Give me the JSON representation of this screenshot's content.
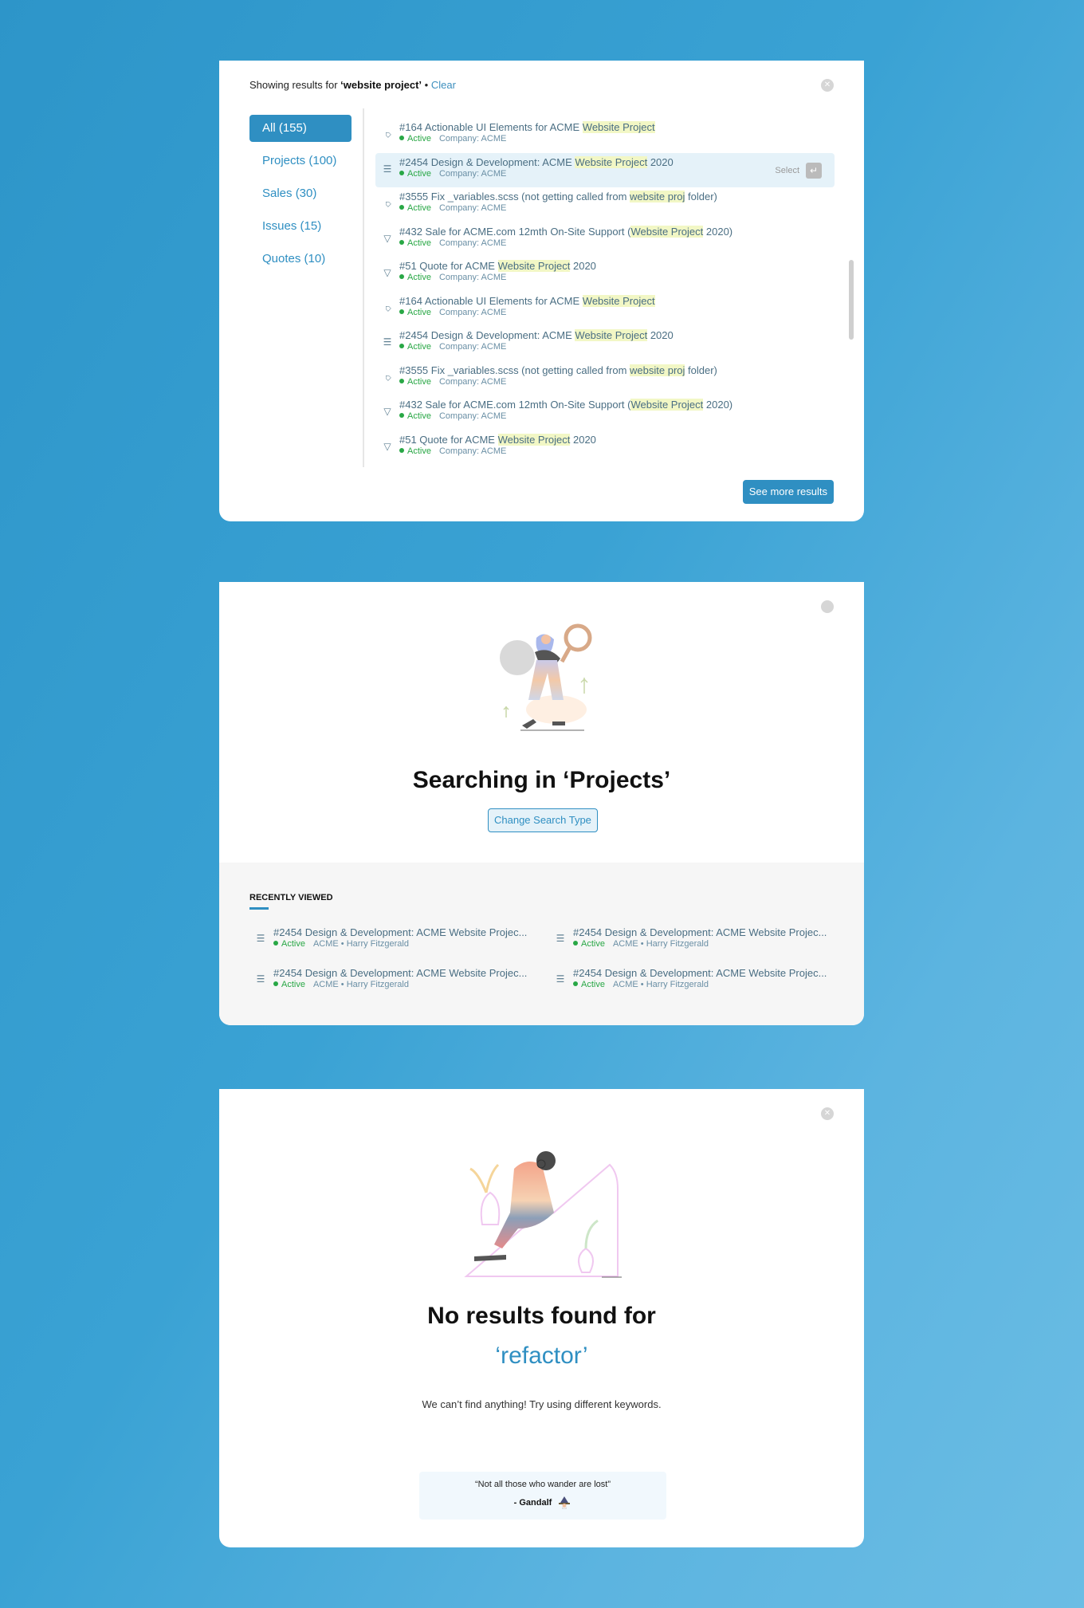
{
  "card1": {
    "showing_prefix": "Showing results for ",
    "query": "‘website project’",
    "separator": " • ",
    "clear_label": "Clear",
    "close_icon": "close-icon",
    "filters": [
      {
        "label": "All (155)",
        "active": true
      },
      {
        "label": "Projects (100)",
        "active": false
      },
      {
        "label": "Sales (30)",
        "active": false
      },
      {
        "label": "Issues (15)",
        "active": false
      },
      {
        "label": "Quotes (10)",
        "active": false
      }
    ],
    "results": [
      {
        "icon": "tag-icon",
        "pre": "#164 Actionable UI Elements for ACME ",
        "hl": "Website Project",
        "post": "",
        "status": "Active",
        "company": "Company: ACME"
      },
      {
        "icon": "project-icon",
        "pre": "#2454 Design & Development: ACME ",
        "hl": "Website Project",
        "post": " 2020",
        "status": "Active",
        "company": "Company: ACME",
        "highlighted": true
      },
      {
        "icon": "tag-icon",
        "pre": "#3555 Fix _variables.scss (not getting called from ",
        "hl": "website proj",
        "post": " folder)",
        "status": "Active",
        "company": "Company: ACME"
      },
      {
        "icon": "funnel-icon",
        "pre": "#432 Sale for ACME.com 12mth On-Site Support (",
        "hl": "Website Project",
        "post": " 2020)",
        "status": "Active",
        "company": "Company: ACME"
      },
      {
        "icon": "funnel-icon",
        "pre": "#51 Quote for ACME ",
        "hl": "Website Project",
        "post": " 2020",
        "status": "Active",
        "company": "Company: ACME"
      },
      {
        "icon": "tag-icon",
        "pre": "#164 Actionable UI Elements for ACME ",
        "hl": "Website Project",
        "post": "",
        "status": "Active",
        "company": "Company: ACME"
      },
      {
        "icon": "project-icon",
        "pre": "#2454 Design & Development: ACME ",
        "hl": "Website Project",
        "post": " 2020",
        "status": "Active",
        "company": "Company: ACME"
      },
      {
        "icon": "tag-icon",
        "pre": "#3555 Fix _variables.scss (not getting called from ",
        "hl": "website proj",
        "post": " folder)",
        "status": "Active",
        "company": "Company: ACME"
      },
      {
        "icon": "funnel-icon",
        "pre": "#432 Sale for ACME.com 12mth On-Site Support (",
        "hl": "Website Project",
        "post": " 2020)",
        "status": "Active",
        "company": "Company: ACME"
      },
      {
        "icon": "funnel-icon",
        "pre": "#51 Quote for ACME ",
        "hl": "Website Project",
        "post": " 2020",
        "status": "Active",
        "company": "Company: ACME"
      }
    ],
    "select_label": "Select",
    "enter_icon": "enter-key-icon",
    "see_more_label": "See more results"
  },
  "card2": {
    "illustration": "woman-with-magnifier-illustration",
    "heading": "Searching in ‘Projects’",
    "change_button": "Change Search Type",
    "recent_title": "RECENTLY VIEWED",
    "recent_items": [
      {
        "title": "#2454 Design & Development: ACME Website Projec...",
        "status": "Active",
        "meta": "ACME • Harry Fitzgerald"
      },
      {
        "title": "#2454 Design & Development: ACME Website Projec...",
        "status": "Active",
        "meta": "ACME • Harry Fitzgerald"
      },
      {
        "title": "#2454 Design & Development: ACME Website Projec...",
        "status": "Active",
        "meta": "ACME • Harry Fitzgerald"
      },
      {
        "title": "#2454 Design & Development: ACME Website Projec...",
        "status": "Active",
        "meta": "ACME • Harry Fitzgerald"
      }
    ]
  },
  "card3": {
    "illustration": "man-sitting-illustration",
    "heading": "No results found for",
    "keyword": "‘refactor’",
    "subtitle": "We can’t find anything! Try using different keywords.",
    "quote": "“Not all those who wander are lost”",
    "author": "- Gandalf",
    "author_icon": "wizard-icon"
  },
  "colors": {
    "accent": "#2f8fc2",
    "active_status": "#28a745",
    "highlight": "#f2f7c5",
    "selected_row": "#e5f2f9"
  }
}
